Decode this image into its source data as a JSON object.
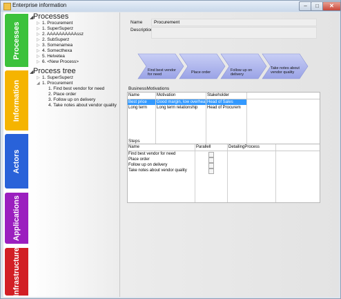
{
  "window": {
    "title": "Enterprise information"
  },
  "tabs": [
    {
      "label": "Processes",
      "color": "#3cc23c"
    },
    {
      "label": "Information",
      "color": "#f5b400"
    },
    {
      "label": "Actors",
      "color": "#2962d9"
    },
    {
      "label": "Applications",
      "color": "#9b1fbf"
    },
    {
      "label": "Infrastructure",
      "color": "#d21f25"
    }
  ],
  "processes": {
    "title": "Processes",
    "items": [
      "1. Procurement",
      "1. SuperSuperz",
      "2. AAAAAAAAAAssz",
      "2. SubSuperz",
      "3. Somenamea",
      "4. Somecthexa",
      "5. Helvetea",
      "6. <New Process>"
    ]
  },
  "process_tree": {
    "title": "Process tree",
    "root_items": [
      "1. SuperSuperz",
      "1. Procurement"
    ],
    "children": [
      "1. Find best vendor for need",
      "2. Place order",
      "3. Follow up on delivery",
      "4. Take notes about vendor quality"
    ]
  },
  "detail": {
    "name_label": "Name",
    "name_value": "Procurement",
    "description_label": "Description",
    "description_value": ""
  },
  "flow_steps": [
    "Find best vendor for need",
    "Place order",
    "Follow up on delivery",
    "Take notes about vendor quality"
  ],
  "business_motivations": {
    "title": "BusinessMotivations",
    "columns": [
      "Name",
      "Motivation",
      "Stakeholder"
    ],
    "rows": [
      [
        "Best price",
        "Good margin, low overhea",
        "Head of Sales"
      ],
      [
        "Long term",
        "Long term relationship",
        "Head of Procurem"
      ]
    ]
  },
  "steps": {
    "title": "Steps",
    "columns": [
      "Name",
      "Parallell",
      "DetailingProcess"
    ],
    "rows": [
      "Find best vendor for need",
      "Place order",
      "Follow up on delivery",
      "Take notes about vendor quality"
    ]
  }
}
